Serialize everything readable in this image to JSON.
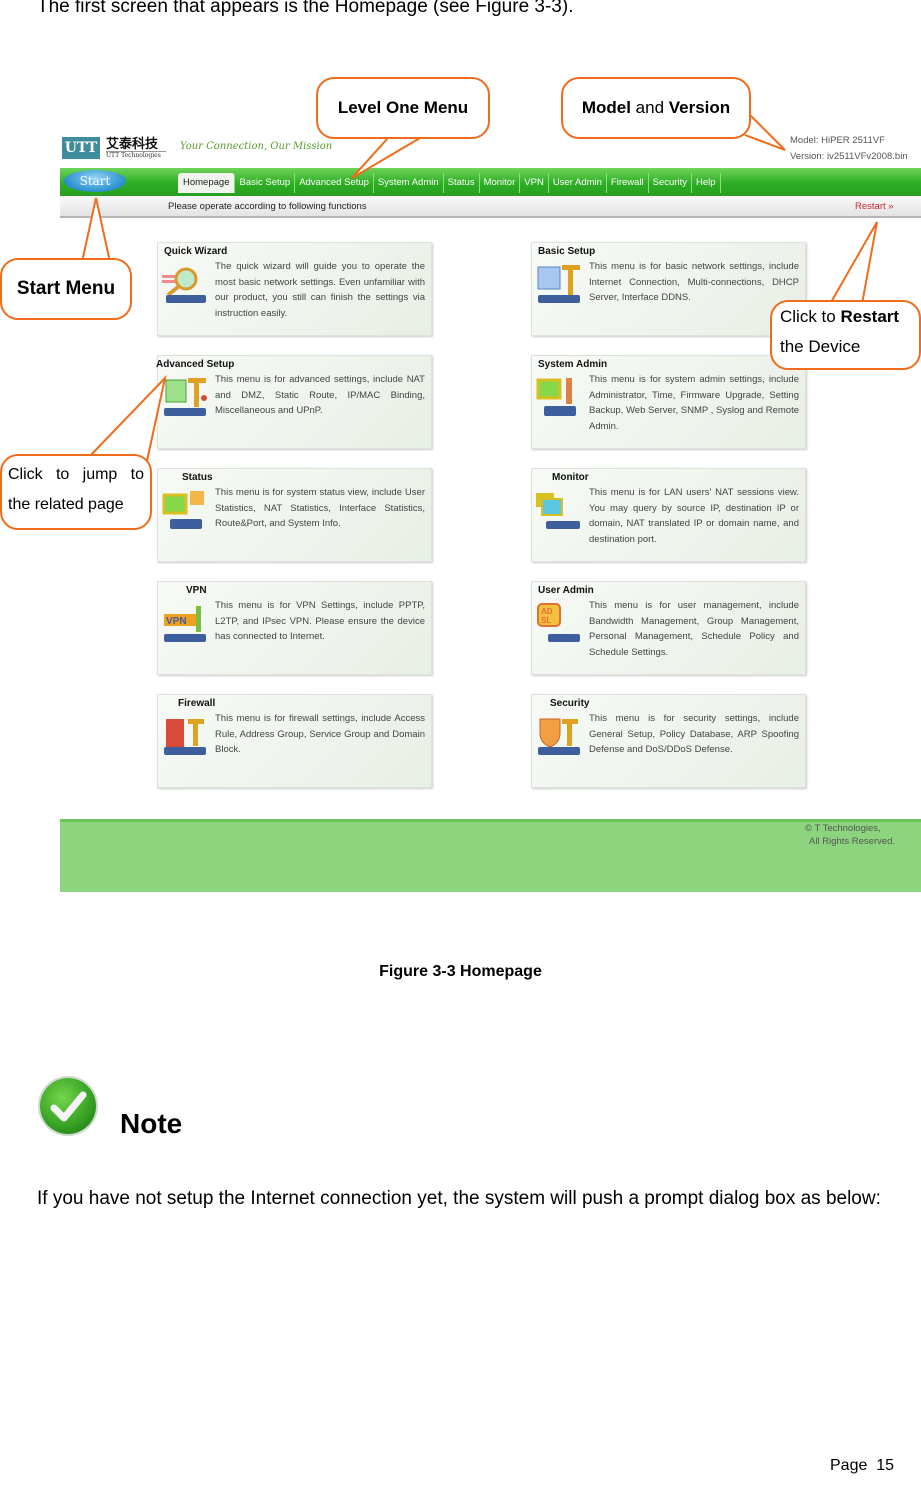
{
  "intro_text": "The first screen that appears is the Homepage (see Figure 3-3).",
  "app": {
    "logo": {
      "mark": "UTT",
      "name_cn": "艾泰科技",
      "name_en": "UTT Technologies",
      "slogan": "Your Connection, Our Mission"
    },
    "model_label": "Model: HiPER 2511VF",
    "version_label": "Version: iv2511VFv2008.bin",
    "start_label": "Start",
    "nav_tabs": [
      {
        "label": "Homepage",
        "active": true
      },
      {
        "label": "Basic Setup"
      },
      {
        "label": "Advanced Setup"
      },
      {
        "label": "System Admin"
      },
      {
        "label": "Status"
      },
      {
        "label": "Monitor"
      },
      {
        "label": "VPN"
      },
      {
        "label": "User Admin"
      },
      {
        "label": "Firewall"
      },
      {
        "label": "Security"
      },
      {
        "label": "Help"
      }
    ],
    "subbar_text": "Please operate according to following functions",
    "restart_label": "Restart »",
    "cards": [
      {
        "title": "Quick Wizard",
        "icon": "magnifier-router-icon",
        "desc": "The quick wizard will guide you to operate the most basic network settings. Even unfamiliar with our product, you still can finish the settings via instruction easily."
      },
      {
        "title": "Basic Setup",
        "icon": "chat-hammer-router-icon",
        "desc": "This menu is for basic network settings, include Internet Connection, Multi-connections, DHCP Server, Interface DDNS."
      },
      {
        "title": "Advanced Setup",
        "icon": "chat-hammer-router-icon",
        "desc": "This menu is for advanced settings, include NAT and DMZ, Static Route, IP/MAC Binding, Miscellaneous and UPnP."
      },
      {
        "title": "System Admin",
        "icon": "computer-wrench-icon",
        "desc": "This menu is for system admin settings, include Administrator, Time, Firmware Upgrade, Setting Backup, Web Server, SNMP , Syslog and Remote Admin."
      },
      {
        "title": "Status",
        "icon": "computer-chat-icon",
        "desc": "This menu is for system status view, include User Statistics, NAT Statistics, Interface Statistics, Route&Port, and System Info."
      },
      {
        "title": "Monitor",
        "icon": "monitors-router-icon",
        "desc": "This menu is for LAN users' NAT sessions view. You may query by source IP, destination IP or domain, NAT translated IP or domain name, and destination port."
      },
      {
        "title": "VPN",
        "icon": "vpn-router-icon",
        "desc": "This menu is for VPN Settings, include PPTP, L2TP, and IPsec VPN. Please ensure the device has connected to Internet."
      },
      {
        "title": "User Admin",
        "icon": "adsl-router-icon",
        "desc": "This menu is for user management, include Bandwidth Management, Group Management, Personal Management, Schedule Policy and Schedule Settings."
      },
      {
        "title": "Firewall",
        "icon": "brick-wall-hammer-icon",
        "desc": "This menu is for firewall settings, include Access Rule, Address Group, Service Group and Domain Block."
      },
      {
        "title": "Security",
        "icon": "shield-hammer-icon",
        "desc": "This menu is for security settings, include General Setup, Policy Database, ARP Spoofing Defense and DoS/DDoS Defense."
      }
    ],
    "copyright": [
      "© T Technologies,",
      "All Rights Reserved."
    ]
  },
  "callouts": {
    "level_one_menu": "Level One Menu",
    "model_version": {
      "bold1": "Model",
      "mid": " and ",
      "bold2": "Version"
    },
    "start_menu": "Start Menu",
    "restart": {
      "pre": "Click to ",
      "bold": "Restart",
      "post": "the Device"
    },
    "jump": "Click to jump to the related page"
  },
  "colors": {
    "callout_border": "#ef6c1a",
    "nav_green": "#2eae25",
    "footer_green": "#8dd47e",
    "restart_red": "#c0292b"
  },
  "caption": "Figure 3-3 Homepage",
  "note": {
    "icon": "checkmark-icon",
    "label": "Note",
    "text": "If you have not setup the Internet connection yet, the system will push a prompt dialog box as below:"
  },
  "page_number": "Page  15"
}
